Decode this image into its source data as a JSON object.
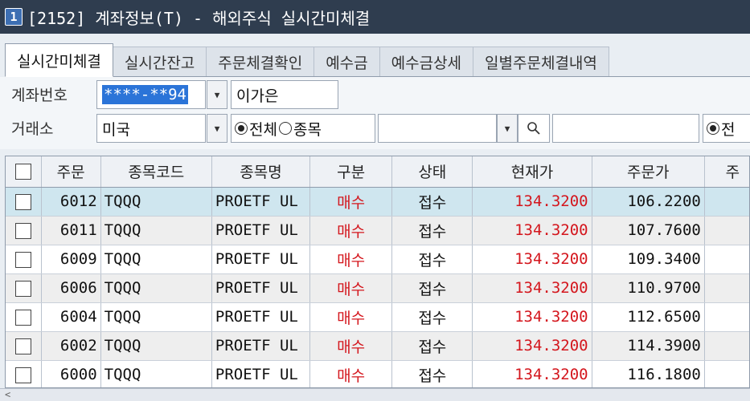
{
  "window": {
    "number": "1",
    "title": "[2152] 계좌정보(T) - 해외주식 실시간미체결"
  },
  "tabs": [
    "실시간미체결",
    "실시간잔고",
    "주문체결확인",
    "예수금",
    "예수금상세",
    "일별주문체결내역"
  ],
  "account": {
    "label": "계좌번호",
    "number": "****-**94",
    "name": "이가은"
  },
  "exchange": {
    "label": "거래소",
    "value": "미국",
    "radio_all": "전체",
    "radio_item": "종목",
    "right_radio": "전"
  },
  "table": {
    "headers": [
      "주문",
      "종목코드",
      "종목명",
      "구분",
      "상태",
      "현재가",
      "주문가",
      "주"
    ],
    "rows": [
      {
        "order": "6012",
        "code": "TQQQ",
        "name": "PROETF UL",
        "side": "매수",
        "status": "접수",
        "price": "134.3200",
        "order_price": "106.2200"
      },
      {
        "order": "6011",
        "code": "TQQQ",
        "name": "PROETF UL",
        "side": "매수",
        "status": "접수",
        "price": "134.3200",
        "order_price": "107.7600"
      },
      {
        "order": "6009",
        "code": "TQQQ",
        "name": "PROETF UL",
        "side": "매수",
        "status": "접수",
        "price": "134.3200",
        "order_price": "109.3400"
      },
      {
        "order": "6006",
        "code": "TQQQ",
        "name": "PROETF UL",
        "side": "매수",
        "status": "접수",
        "price": "134.3200",
        "order_price": "110.9700"
      },
      {
        "order": "6004",
        "code": "TQQQ",
        "name": "PROETF UL",
        "side": "매수",
        "status": "접수",
        "price": "134.3200",
        "order_price": "112.6500"
      },
      {
        "order": "6002",
        "code": "TQQQ",
        "name": "PROETF UL",
        "side": "매수",
        "status": "접수",
        "price": "134.3200",
        "order_price": "114.3900"
      },
      {
        "order": "6000",
        "code": "TQQQ",
        "name": "PROETF UL",
        "side": "매수",
        "status": "접수",
        "price": "134.3200",
        "order_price": "116.1800"
      }
    ]
  },
  "colors": {
    "titlebar": "#2f3d4f",
    "selected_row": "#cfe6ef",
    "price_red": "#d4161d"
  },
  "icons": {
    "search": "search-icon",
    "dropdown": "chevron-down-icon",
    "scroll_left": "scroll-left-arrow"
  }
}
